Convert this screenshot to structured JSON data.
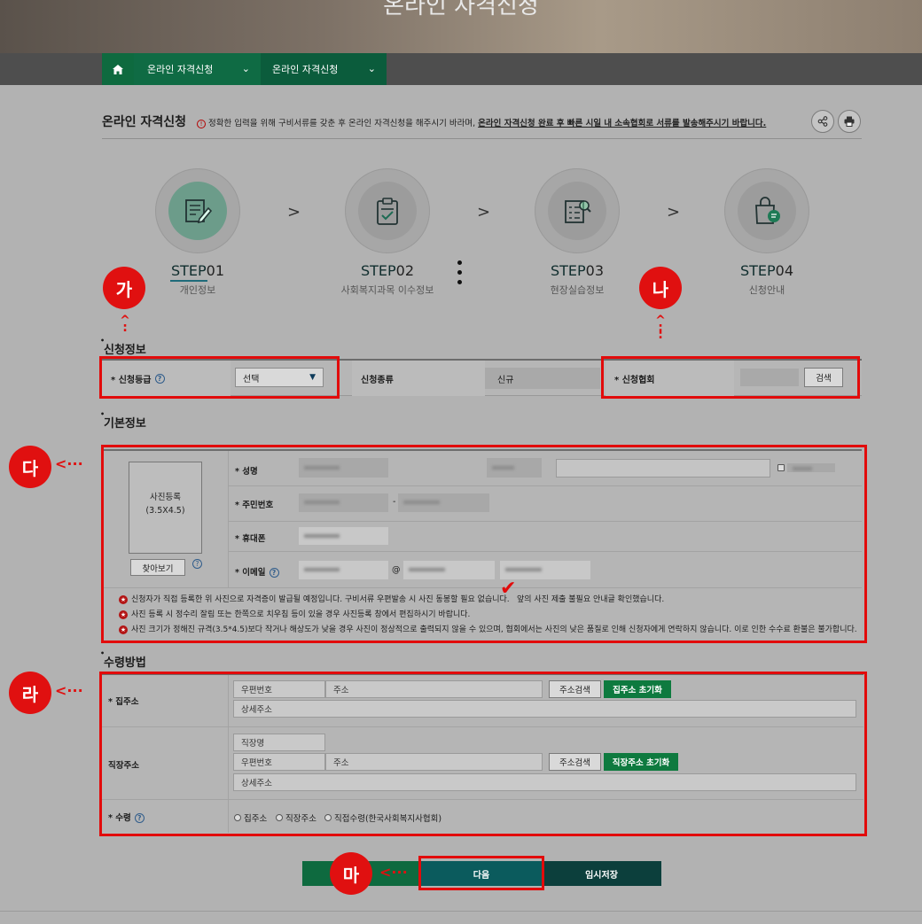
{
  "hero": {
    "title": "온라인 자격신청"
  },
  "nav": {
    "menu1": "온라인 자격신청",
    "menu2": "온라인 자격신청"
  },
  "page": {
    "title": "온라인 자격신청",
    "notice_prefix": "정확한 입력을 위해 구비서류를 갖춘 후 온라인 자격신청을 해주시기 바라며, ",
    "notice_emph": "온라인 자격신청 완료 후 빠른 시일 내 소속협회로 서류를 발송해주시기 바랍니다."
  },
  "steps": [
    {
      "step": "STEP",
      "num": "01",
      "label": "개인정보"
    },
    {
      "step": "STEP",
      "num": "02",
      "label": "사회복지과목 이수정보"
    },
    {
      "step": "STEP",
      "num": "03",
      "label": "현장실습정보"
    },
    {
      "step": "STEP",
      "num": "04",
      "label": "신청안내"
    }
  ],
  "badges": {
    "a": "가",
    "b": "나",
    "c": "다",
    "d": "라",
    "e": "마"
  },
  "apply": {
    "section_title": "신청정보",
    "grade_label": "* 신청등급",
    "grade_select": "선택",
    "type_label": "신청종류",
    "type_value": "신규",
    "assoc_label": "* 신청협회",
    "search_btn": "검색"
  },
  "basic": {
    "section_title": "기본정보",
    "photo_text_1": "사진등록",
    "photo_text_2": "(3.5X4.5)",
    "browse_btn": "찾아보기",
    "name_label": "* 성명",
    "rrn_label": "* 주민번호",
    "rrn_sep": "-",
    "phone_label": "* 휴대폰",
    "email_label": "* 이메일",
    "email_at": "@",
    "notes": [
      "신청자가 직접 등록한 위 사진으로 자격증이 발급될 예정입니다. 구비서류 우편발송 시 사진 동봉할 필요 없습니다.",
      "앞의 사진 제출 불필요 안내글 확인했습니다.",
      "사진 등록 시 정수리 잘림 또는 한쪽으로 치우침 등이 있을 경우 사진등록 창에서 편집하시기 바랍니다.",
      "사진 크기가 정해진 규격(3.5*4.5)보다 작거나 해상도가 낮을 경우 사진이 정상적으로 출력되지 않을 수 있으며, 협회에서는 사진의 낮은 품질로 인해 신청자에게 연락하지 않습니다. 이로 인한 수수료 환불은 불가합니다."
    ]
  },
  "receive": {
    "section_title": "수령방법",
    "home_label": "* 집주소",
    "postcode_ph": "우편번호",
    "address_ph": "주소",
    "detail_ph": "상세주소",
    "addr_search_btn": "주소검색",
    "home_reset_btn": "집주소 초기화",
    "work_label": "직장주소",
    "workplace_ph": "직장명",
    "work_reset_btn": "직장주소 초기화",
    "method_label": "* 수령",
    "options": [
      "집주소",
      "직장주소",
      "직접수령(한국사회복지사협회)"
    ]
  },
  "buttons": {
    "next": "다음",
    "temp_save": "임시저장"
  },
  "colors": {
    "accent_green": "#0e7a3f",
    "highlight_red": "#e20b0b",
    "teal": "#0b5b5d"
  }
}
